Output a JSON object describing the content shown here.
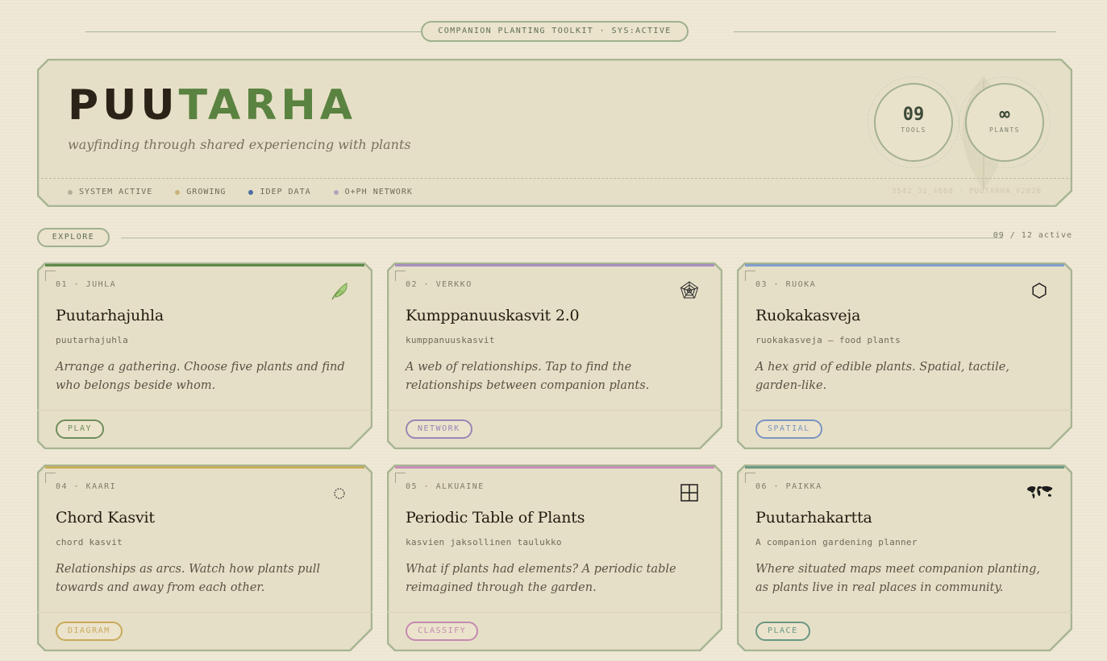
{
  "top": {
    "badge": "COMPANION PLANTING TOOLKIT · SYS:ACTIVE"
  },
  "hero": {
    "title_a": "PUU",
    "title_b": "TARHA",
    "subtitle": "wayfinding through shared experiencing with plants",
    "status": [
      {
        "label": "SYSTEM ACTIVE",
        "color": "#b6b09a"
      },
      {
        "label": "GROWING",
        "color": "#c9b47a"
      },
      {
        "label": "IDEP DATA",
        "color": "#4a6da3"
      },
      {
        "label": "O+PH NETWORK",
        "color": "#b1a6c0"
      }
    ],
    "code": "3542_32_4668 · PUUTARHA_V2026",
    "stats": [
      {
        "value": "09",
        "label": "TOOLS"
      },
      {
        "value": "∞",
        "label": "PLANTS"
      }
    ]
  },
  "explore": {
    "label": "EXPLORE",
    "count": "09 / 12 active"
  },
  "colors": {
    "border": "#a7b593",
    "card_bg": "#e6dfc7",
    "brand_green": "#5a8240"
  },
  "cards": [
    {
      "number": "01 · JUHLA",
      "title": "Puutarhajuhla",
      "subtitle": "puutarhajuhla",
      "description": "Arrange a gathering. Choose five plants and find who belongs beside whom.",
      "tag": "PLAY",
      "accent": "#5d8a49",
      "tag_color": "#6f8d5c",
      "icon": "leaf-icon"
    },
    {
      "number": "02 · VERKKO",
      "title": "Kumppanuuskasvit 2.0",
      "subtitle": "kumppanuuskasvit",
      "description": "A web of relationships. Tap to find the relationships between companion plants.",
      "tag": "NETWORK",
      "accent": "#a88fbf",
      "tag_color": "#9a86b7",
      "icon": "web-icon"
    },
    {
      "number": "03 · RUOKA",
      "title": "Ruokakasveja",
      "subtitle": "ruokakasveja — food plants",
      "description": "A hex grid of edible plants. Spatial, tactile, garden-like.",
      "tag": "SPATIAL",
      "accent": "#7f9ec9",
      "tag_color": "#7a95c0",
      "icon": "hexagon-icon"
    },
    {
      "number": "04 · KAARI",
      "title": "Chord Kasvit",
      "subtitle": "chord kasvit",
      "description": "Relationships as arcs. Watch how plants pull towards and away from each other.",
      "tag": "DIAGRAM",
      "accent": "#c9ad5a",
      "tag_color": "#c8aa5a",
      "icon": "dotted-circle-icon"
    },
    {
      "number": "05 · ALKUAINE",
      "title": "Periodic Table of Plants",
      "subtitle": "kasvien jaksollinen taulukko",
      "description": "What if plants had elements? A periodic table reimagined through the garden.",
      "tag": "CLASSIFY",
      "accent": "#c98fb8",
      "tag_color": "#c48bb0",
      "icon": "grid-icon"
    },
    {
      "number": "06 · PAIKKA",
      "title": "Puutarhakartta",
      "subtitle": "A companion gardening planner",
      "description": "Where situated maps meet companion planting, as plants live in real places in community.",
      "tag": "PLACE",
      "accent": "#6c9a84",
      "tag_color": "#6a9784",
      "icon": "world-map-icon"
    }
  ]
}
